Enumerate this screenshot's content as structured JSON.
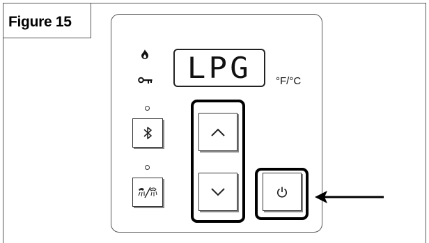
{
  "figure": {
    "label": "Figure 15"
  },
  "display": {
    "text": "LPG"
  },
  "units": {
    "label": "°F/°C"
  },
  "indicators": {
    "flame": "flame-icon",
    "lock": "key-icon"
  },
  "buttons": {
    "bluetooth": {
      "icon": "bluetooth-icon"
    },
    "mode": {
      "icon": "shower-mode-icon"
    },
    "up": {
      "icon": "chevron-up-icon"
    },
    "down": {
      "icon": "chevron-down-icon"
    },
    "power": {
      "icon": "power-icon"
    }
  },
  "colors": {
    "outline": "#000000",
    "panel_border": "#555555"
  }
}
